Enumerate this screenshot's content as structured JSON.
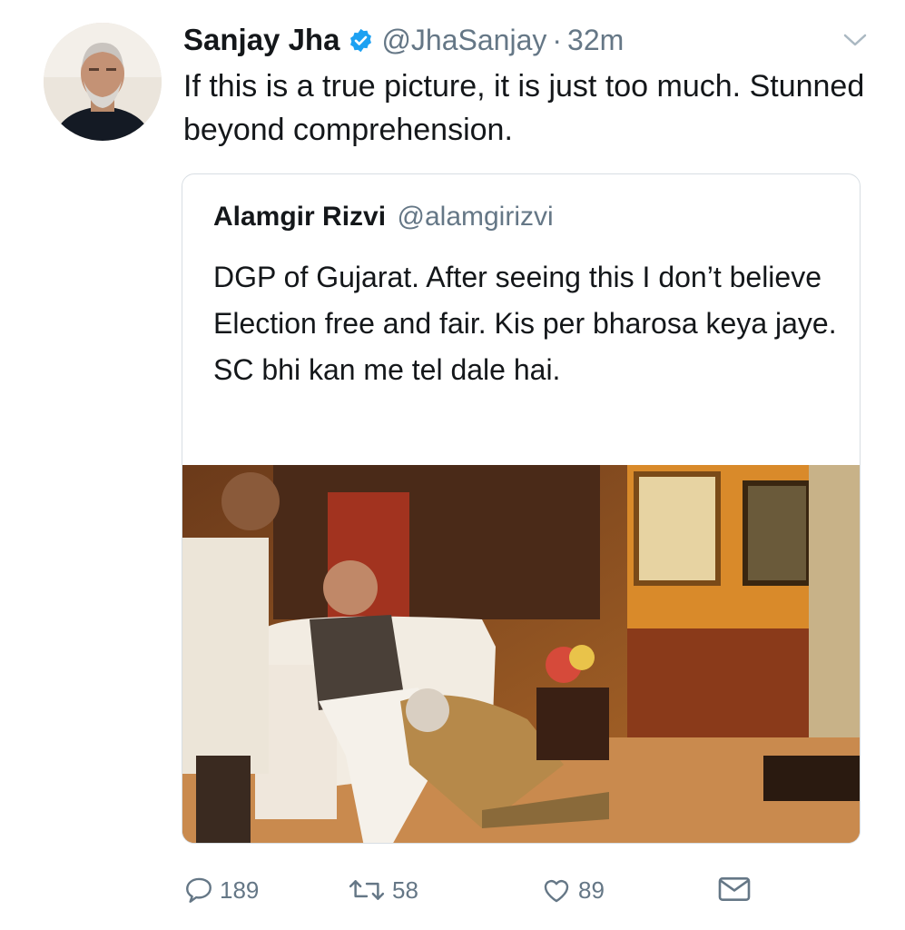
{
  "tweet": {
    "author_name": "Sanjay Jha",
    "author_handle": "@JhaSanjay",
    "separator": "·",
    "time": "32m",
    "text": "If this is a true picture, it is just too much. Stunned beyond comprehension.",
    "avatar_icon": "profile-photo",
    "verified_icon": "verified-badge",
    "menu_icon": "chevron-down-icon"
  },
  "quoted": {
    "author_name": "Alamgir Rizvi",
    "author_handle": "@alamgirizvi",
    "text": "DGP of Gujarat. After seeing this I don’t believe Election free and fair. Kis per bharosa keya jaye. SC bhi kan me tel dale hai.",
    "media": "photo"
  },
  "actions": {
    "reply_count": "189",
    "retweet_count": "58",
    "like_count": "89"
  },
  "colors": {
    "text": "#14171a",
    "secondary": "#657786",
    "verified": "#1da1f2",
    "border": "#d8dee3"
  }
}
